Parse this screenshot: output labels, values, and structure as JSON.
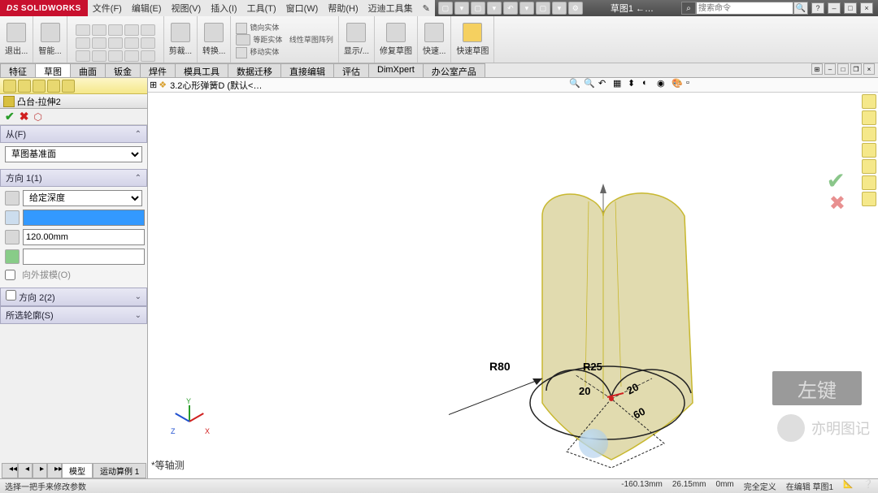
{
  "app": {
    "name": "SOLIDWORKS",
    "doc_title": "草图1 ←…"
  },
  "menu": [
    "文件(F)",
    "编辑(E)",
    "视图(V)",
    "插入(I)",
    "工具(T)",
    "窗口(W)",
    "帮助(H)",
    "迈迪工具集",
    "✎"
  ],
  "search": {
    "placeholder": "搜索命令"
  },
  "ribbon": {
    "exit": "退出...",
    "smart": "智能...",
    "trim": "剪裁...",
    "convert": "转换...",
    "mirror": "镜向实体",
    "linear": "线性草图阵列",
    "move": "移动实体",
    "offset": "等距实体",
    "display": "显示/...",
    "repair": "修复草图",
    "quick": "快速...",
    "sketch": "快速草图"
  },
  "tabs": [
    "特征",
    "草图",
    "曲面",
    "钣金",
    "焊件",
    "模具工具",
    "数据迁移",
    "直接编辑",
    "评估",
    "DimXpert",
    "办公室产品"
  ],
  "active_tab": "草图",
  "crumb": "3.2心形弹簧D  (默认<…",
  "feature": {
    "title": "凸台-拉伸2",
    "from_label": "从(F)",
    "from_value": "草图基准面",
    "dir1_label": "方向 1(1)",
    "end_cond": "给定深度",
    "depth": "120.00mm",
    "draft_label": "向外拔模(O)",
    "dir2_label": "方向 2(2)",
    "contour_label": "所选轮廓(S)"
  },
  "dims": {
    "r80": "R80",
    "r25": "R25",
    "d20a": "20",
    "d20b": "20",
    "d60": "60"
  },
  "viewlabel": "*等轴测",
  "bottom_tabs": [
    "模型",
    "运动算例 1"
  ],
  "status": {
    "left": "选择一把手来修改参数",
    "x": "-160.13mm",
    "y": "26.15mm",
    "z": "0mm",
    "def": "完全定义",
    "edit": "在编辑 草图1"
  },
  "overlay": {
    "zuojian": "左键",
    "wx": "亦明图记"
  }
}
